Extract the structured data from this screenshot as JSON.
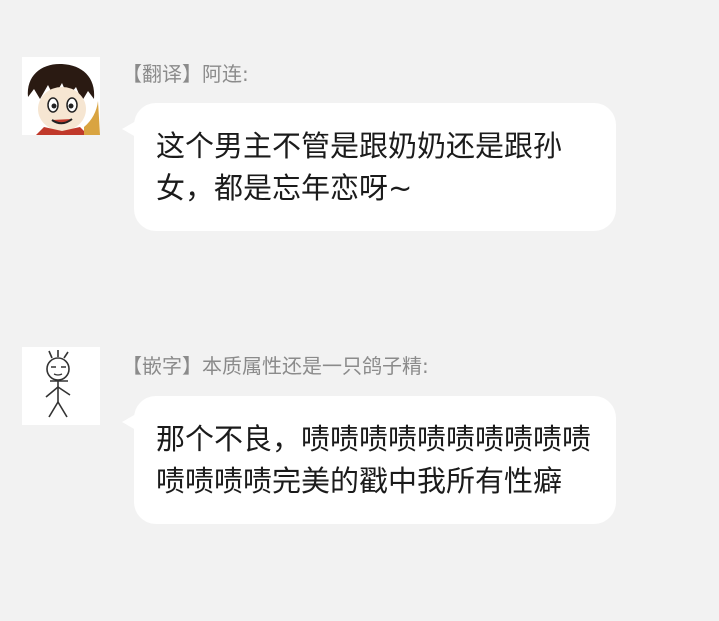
{
  "messages": [
    {
      "sender": "【翻译】阿连:",
      "text": "这个男主不管是跟奶奶还是跟孙女，都是忘年恋呀~",
      "avatar": "manga-boy-avatar-icon"
    },
    {
      "sender": "【嵌字】本质属性还是一只鸽子精:",
      "text": "那个不良，啧啧啧啧啧啧啧啧啧啧啧啧啧啧完美的戳中我所有性癖",
      "avatar": "doodle-figure-avatar-icon"
    }
  ],
  "colors": {
    "background": "#f2f2f2",
    "bubble": "#ffffff",
    "sender_text": "#8b8b8b",
    "message_text": "#1b1b1b"
  }
}
